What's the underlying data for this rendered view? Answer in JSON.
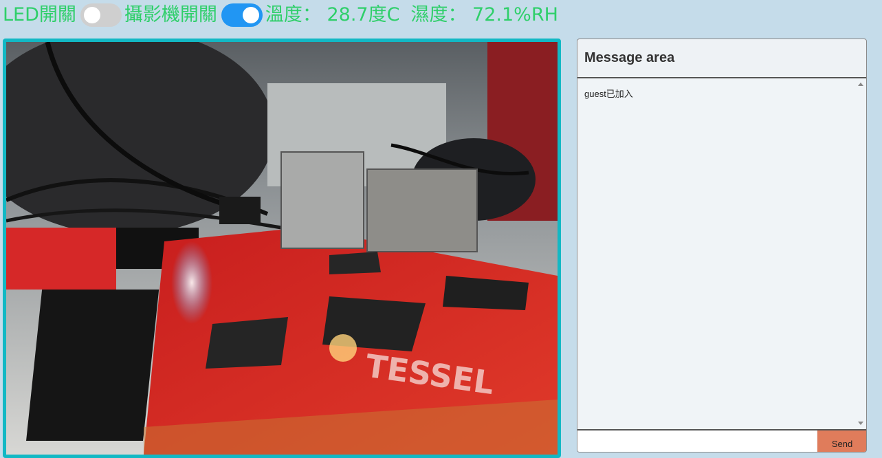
{
  "toolbar": {
    "led_label": "LED開關",
    "led_switch_on": false,
    "camera_label": "攝影機開關",
    "camera_switch_on": true,
    "temperature_text": "溫度： 28.7度C",
    "humidity_text": "濕度： 72.1%RH"
  },
  "colors": {
    "accent_text": "#2fcf6a",
    "frame_border": "#12b8c4",
    "switch_on": "#2196f3",
    "switch_off": "#cfcfcf",
    "send_button": "#e07c5b",
    "page_bg": "#c5dcea"
  },
  "camera": {
    "stream_icon": "camera-stream-icon",
    "board_text": "TESSEL"
  },
  "messages": {
    "title": "Message area",
    "log": [
      "guest已加入"
    ],
    "input_value": "",
    "send_label": "Send"
  }
}
